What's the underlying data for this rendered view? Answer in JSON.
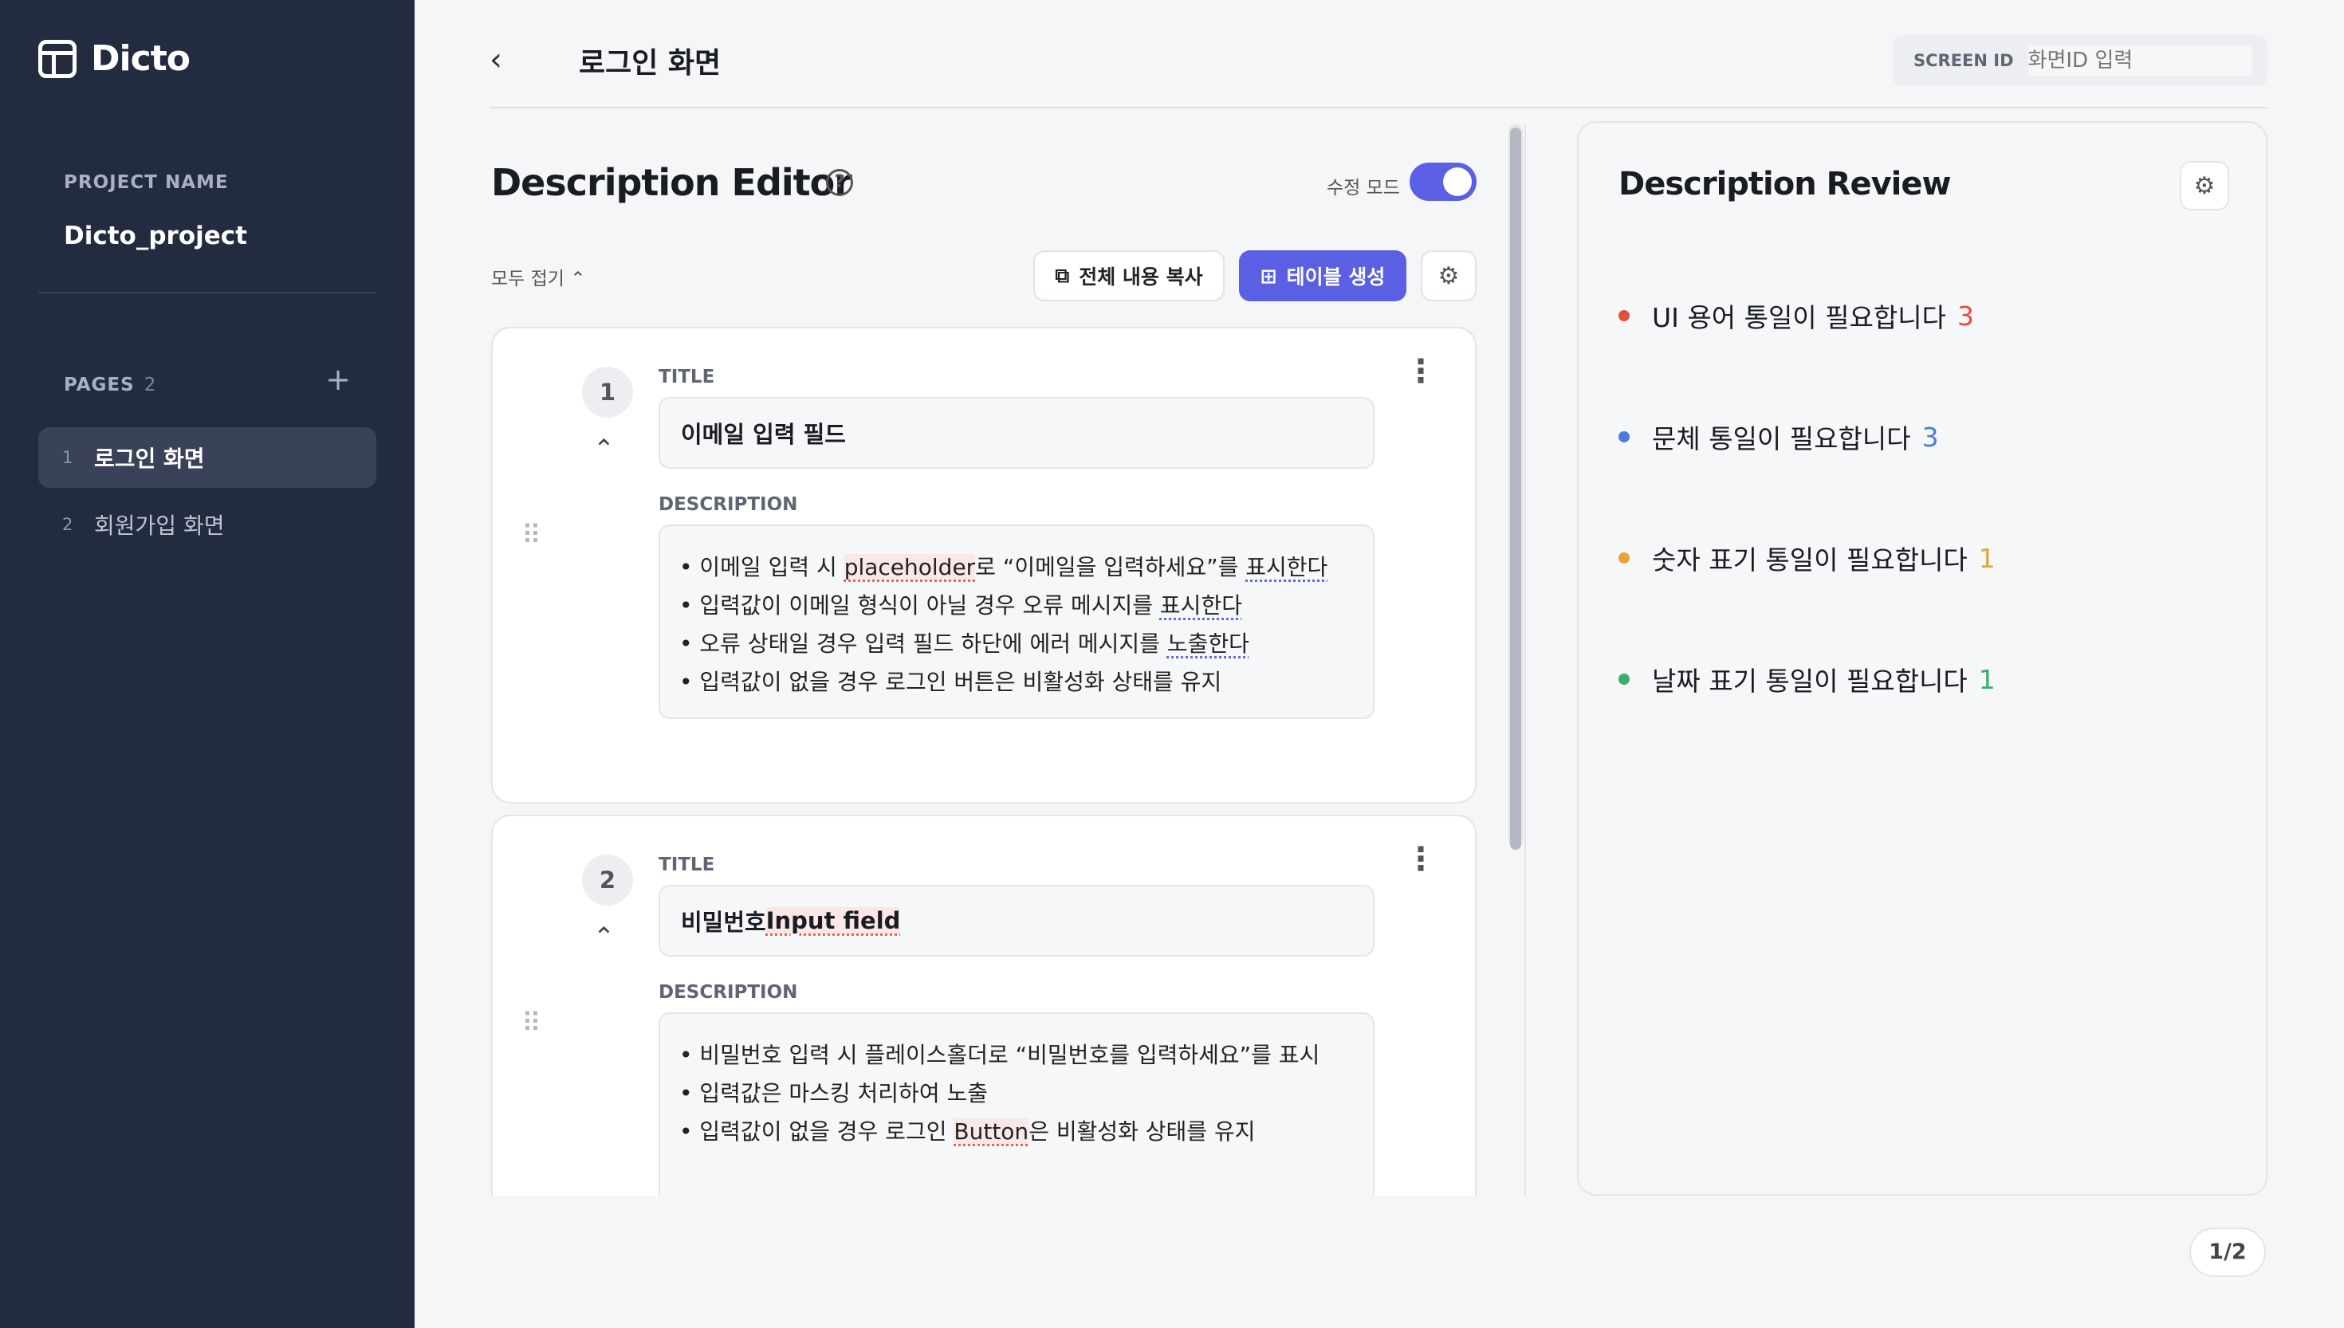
{
  "app": {
    "name": "Dicto"
  },
  "sidebar": {
    "project_label": "PROJECT NAME",
    "project_name": "Dicto_project",
    "pages_label": "PAGES",
    "pages_count": "2",
    "add_icon": "plus-icon",
    "pages": [
      {
        "num": "1",
        "label": "로그인 화면",
        "active": true
      },
      {
        "num": "2",
        "label": "회원가입 화면",
        "active": false
      }
    ]
  },
  "header": {
    "back_icon": "chevron-left-icon",
    "title": "로그인 화면",
    "screen_id_label": "SCREEN ID",
    "screen_id_placeholder": "화면ID 입력"
  },
  "editor": {
    "title": "Description Editor",
    "help_icon": "?",
    "mode_label": "수정 모드",
    "mode_on": true,
    "collapse_label": "모두 접기",
    "copy_label": "전체 내용 복사",
    "table_label": "테이블 생성",
    "title_field_label": "TITLE",
    "desc_field_label": "DESCRIPTION",
    "items": [
      {
        "num": "1",
        "title": "이메일 입력 필드",
        "desc": [
          {
            "pre": "• 이메일 입력 시 ",
            "a": "placeholder",
            "mid": "로 “이메일을 입력하세요”를 ",
            "b": "표시한다"
          },
          {
            "pre": "• 입력값이 이메일 형식이 아닐 경우 오류 메시지를 ",
            "b": "표시한다"
          },
          {
            "pre": "• 오류 상태일 경우 입력 필드 하단에 에러 메시지를 ",
            "b": "노출한다"
          },
          {
            "pre": "• 입력값이 없을 경우 로그인 버튼은 비활성화 상태를 유지"
          }
        ]
      },
      {
        "num": "2",
        "title_pre": "비밀번호 ",
        "title_err": "Input field",
        "desc": [
          {
            "pre": "• 비밀번호 입력 시 플레이스홀더로 “비밀번호를 입력하세요”를 표시"
          },
          {
            "pre": "• 입력값은 마스킹 처리하여 노출"
          },
          {
            "pre": "• 입력값이 없을 경우 로그인 ",
            "a": "Button",
            "mid": "은 비활성화 상태를 유지"
          }
        ]
      }
    ]
  },
  "review": {
    "title": "Description Review",
    "items": [
      {
        "label": "UI 용어 통일이 필요합니다",
        "count": "3",
        "color": "#e0503c"
      },
      {
        "label": "문체 통일이 필요합니다",
        "count": "3",
        "color": "#4a7de0"
      },
      {
        "label": "숫자 표기 통일이 필요합니다",
        "count": "1",
        "color": "#e9a23b"
      },
      {
        "label": "날짜 표기 통일이 필요합니다",
        "count": "1",
        "color": "#3cae6a"
      }
    ]
  },
  "pager": "1/2"
}
